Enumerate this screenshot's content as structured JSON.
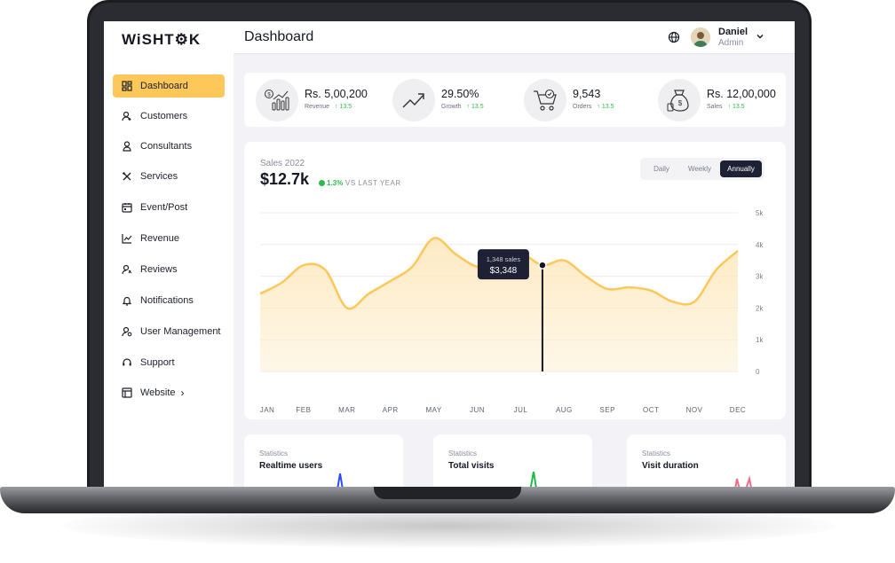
{
  "app": {
    "logo": "WiSHT⚙K"
  },
  "sidebar": {
    "items": [
      {
        "label": "Dashboard",
        "icon": "dashboard-icon",
        "active": true
      },
      {
        "label": "Customers",
        "icon": "customers-icon"
      },
      {
        "label": "Consultants",
        "icon": "consultants-icon"
      },
      {
        "label": "Services",
        "icon": "services-icon"
      },
      {
        "label": "Event/Post",
        "icon": "calendar-icon"
      },
      {
        "label": "Revenue",
        "icon": "revenue-icon"
      },
      {
        "label": "Reviews",
        "icon": "reviews-icon"
      },
      {
        "label": "Notifications",
        "icon": "bell-icon"
      },
      {
        "label": "User Management",
        "icon": "user-management-icon"
      },
      {
        "label": "Support",
        "icon": "headset-icon"
      },
      {
        "label": "Website",
        "icon": "website-icon"
      }
    ],
    "website_chevron": "›"
  },
  "header": {
    "title": "Dashboard",
    "user_name": "Daniel",
    "user_role": "Admin"
  },
  "stats": [
    {
      "value": "Rs. 5,00,200",
      "label": "Revenue",
      "delta": "↑ 13.5",
      "icon": "revenue-chart-icon"
    },
    {
      "value": "29.50%",
      "label": "Growth",
      "delta": "↑ 13.5",
      "icon": "growth-arrow-icon"
    },
    {
      "value": "9,543",
      "label": "Orders",
      "delta": "↑ 13.5",
      "icon": "cart-icon"
    },
    {
      "value": "Rs. 12,00,000",
      "label": "Sales",
      "delta": "↑ 13.5",
      "icon": "money-bag-icon"
    }
  ],
  "sales_card": {
    "title": "Sales 2022",
    "total": "$12.7k",
    "change": "1.3%",
    "vs": "VS LAST YEAR",
    "periods": [
      "Daily",
      "Weekly",
      "Annually"
    ],
    "active_period": "Annually"
  },
  "chart_data": {
    "type": "area",
    "title": "Sales 2022",
    "categories": [
      "JAN",
      "FEB",
      "MAR",
      "APR",
      "MAY",
      "JUN",
      "JUL",
      "AUG",
      "SEP",
      "OCT",
      "NOV",
      "DEC"
    ],
    "x": [
      0,
      0.5,
      1,
      1.5,
      2,
      2.5,
      3,
      3.5,
      4,
      4.5,
      5,
      5.5,
      6,
      6.5,
      7,
      7.5,
      8,
      8.5,
      9,
      9.5,
      10,
      10.5,
      11
    ],
    "values": [
      2450,
      2800,
      3350,
      3200,
      2000,
      2450,
      2850,
      3300,
      4200,
      3700,
      3300,
      3350,
      3700,
      3348,
      3500,
      3000,
      2600,
      2650,
      2550,
      2200,
      2200,
      3200,
      3800
    ],
    "yticks": [
      "0",
      "1k",
      "2k",
      "3k",
      "4k",
      "5k"
    ],
    "ylim": [
      0,
      5000
    ],
    "grid": true,
    "line_color": "#fdc75a",
    "fill_color": "#fde9bf",
    "tooltip": {
      "category_index": 6.5,
      "value": 3348,
      "line1": "1,348 sales",
      "line2": "$3,348"
    }
  },
  "mini_cards": [
    {
      "caption": "Statistics",
      "title": "Realtime users",
      "value": "",
      "color": "#2b4cff"
    },
    {
      "caption": "Statistics",
      "title": "Total visits",
      "value": "",
      "color": "#1fb84a"
    },
    {
      "caption": "Statistics",
      "title": "Visit duration",
      "value": "",
      "color": "#f06b8a"
    }
  ]
}
